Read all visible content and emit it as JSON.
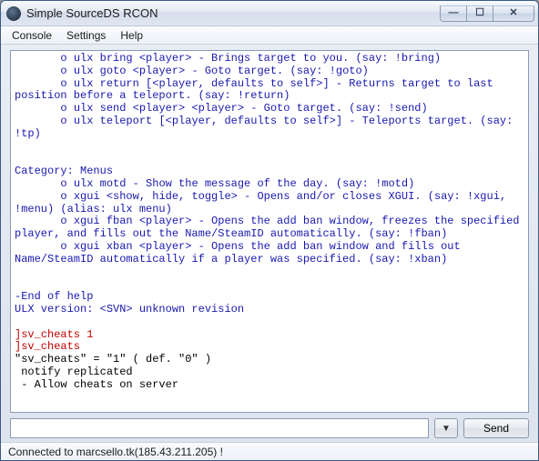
{
  "window": {
    "title": "Simple SourceDS RCON"
  },
  "menubar": {
    "items": [
      "Console",
      "Settings",
      "Help"
    ]
  },
  "console": {
    "lines": [
      {
        "cls": "blue",
        "text": "       o ulx bring <player> - Brings target to you. (say: !bring)"
      },
      {
        "cls": "blue",
        "text": "       o ulx goto <player> - Goto target. (say: !goto)"
      },
      {
        "cls": "blue",
        "text": "       o ulx return [<player, defaults to self>] - Returns target to last position before a teleport. (say: !return)"
      },
      {
        "cls": "blue",
        "text": "       o ulx send <player> <player> - Goto target. (say: !send)"
      },
      {
        "cls": "blue",
        "text": "       o ulx teleport [<player, defaults to self>] - Teleports target. (say: !tp)"
      },
      {
        "cls": "blue",
        "text": ""
      },
      {
        "cls": "blue",
        "text": ""
      },
      {
        "cls": "blue",
        "text": "Category: Menus"
      },
      {
        "cls": "blue",
        "text": "       o ulx motd - Show the message of the day. (say: !motd)"
      },
      {
        "cls": "blue",
        "text": "       o xgui <show, hide, toggle> - Opens and/or closes XGUI. (say: !xgui, !menu) (alias: ulx menu)"
      },
      {
        "cls": "blue",
        "text": "       o xgui fban <player> - Opens the add ban window, freezes the specified player, and fills out the Name/SteamID automatically. (say: !fban)"
      },
      {
        "cls": "blue",
        "text": "       o xgui xban <player> - Opens the add ban window and fills out Name/SteamID automatically if a player was specified. (say: !xban)"
      },
      {
        "cls": "blue",
        "text": ""
      },
      {
        "cls": "blue",
        "text": ""
      },
      {
        "cls": "blue",
        "text": "-End of help"
      },
      {
        "cls": "blue",
        "text": "ULX version: <SVN> unknown revision"
      },
      {
        "cls": "blue",
        "text": ""
      },
      {
        "cls": "red",
        "text": "]sv_cheats 1"
      },
      {
        "cls": "red",
        "text": "]sv_cheats"
      },
      {
        "cls": "black",
        "text": "\"sv_cheats\" = \"1\" ( def. \"0\" )"
      },
      {
        "cls": "black",
        "text": " notify replicated"
      },
      {
        "cls": "black",
        "text": " - Allow cheats on server"
      },
      {
        "cls": "black",
        "text": ""
      }
    ]
  },
  "input": {
    "value": "",
    "placeholder": ""
  },
  "buttons": {
    "send": "Send",
    "dropdown_glyph": "▼"
  },
  "win_controls": {
    "min": "—",
    "max": "☐",
    "close": "✕"
  },
  "status": {
    "text": "Connected to marcsello.tk(185.43.211.205) !"
  }
}
